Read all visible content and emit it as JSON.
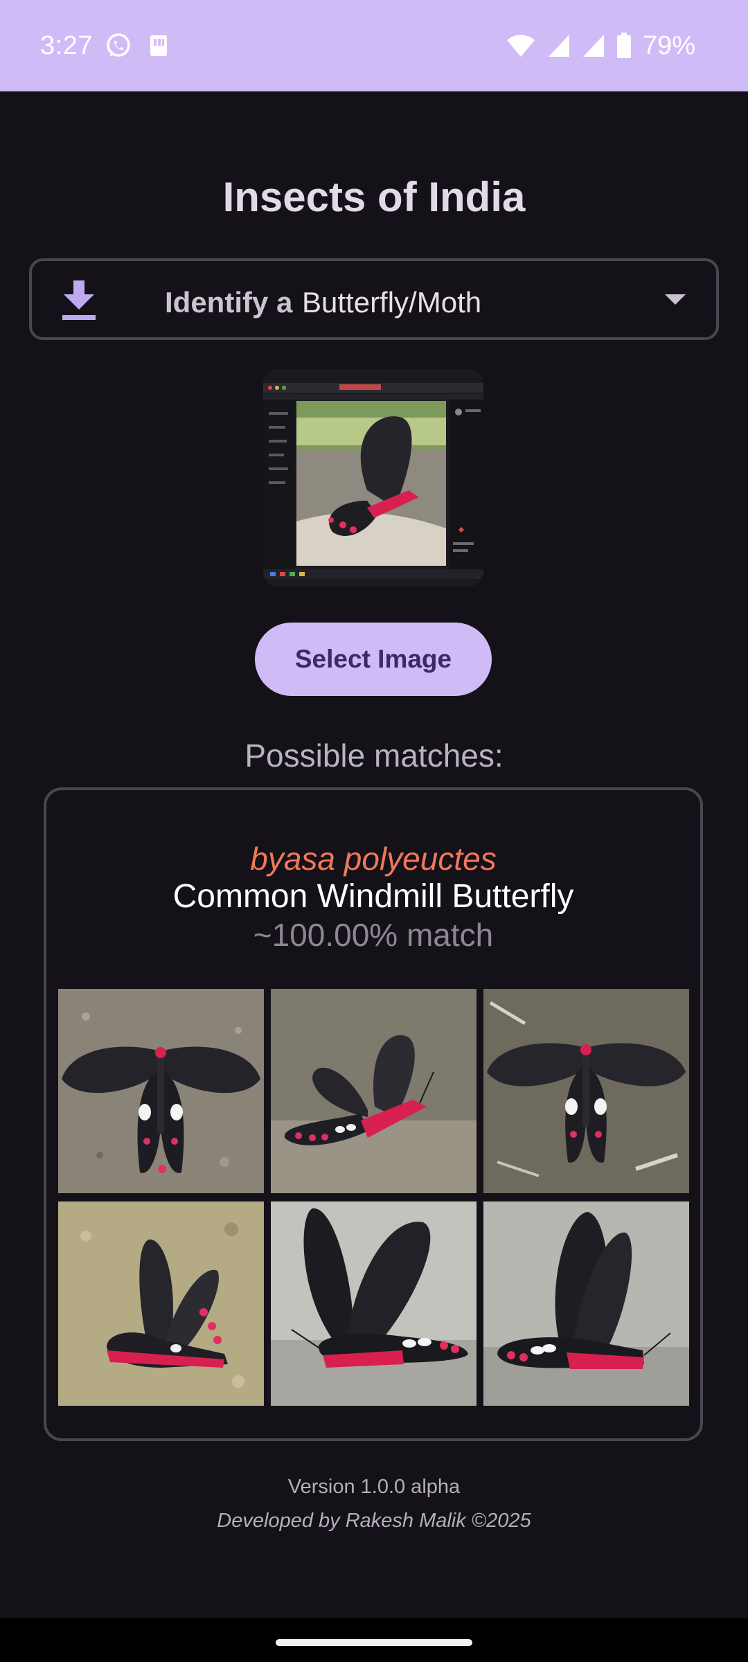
{
  "status_bar": {
    "time": "3:27",
    "battery": "79%",
    "icons": [
      "whatsapp-icon",
      "sim-icon",
      "wifi-icon",
      "signal-icon",
      "signal-icon",
      "battery-icon"
    ]
  },
  "app": {
    "title": "Insects of India"
  },
  "identify": {
    "label": "Identify a",
    "selected_value": "Butterfly/Moth",
    "icon": "download-icon",
    "dropdown_icon": "chevron-down-icon"
  },
  "actions": {
    "select_image_label": "Select Image"
  },
  "results": {
    "heading": "Possible matches:",
    "match": {
      "scientific_name": "byasa polyeuctes",
      "common_name": "Common Windmill Butterfly",
      "confidence": "~100.00% match"
    }
  },
  "footer": {
    "version": "Version 1.0.0 alpha",
    "developer": "Developed by Rakesh Malik ©2025"
  },
  "colors": {
    "accent": "#cfbcf7",
    "background": "#141218",
    "scientific_name": "#f0785a"
  }
}
